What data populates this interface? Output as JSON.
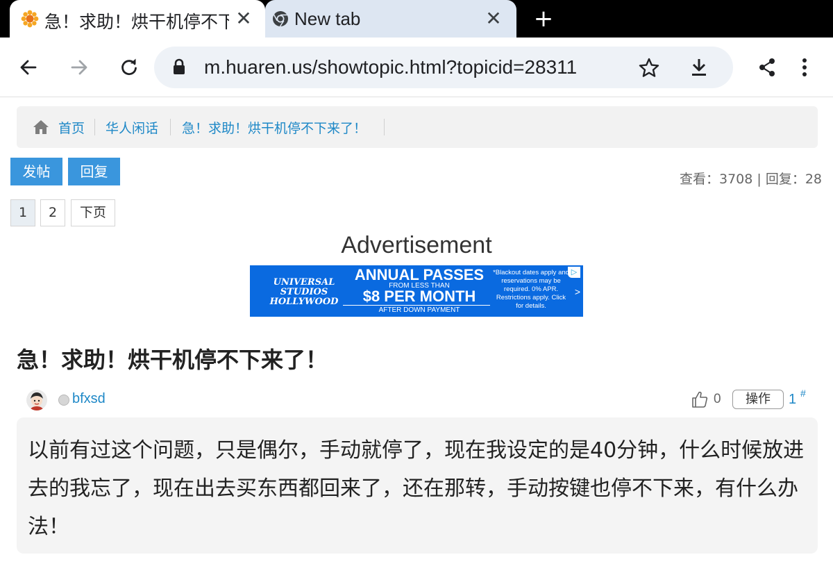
{
  "browser": {
    "tabs": [
      {
        "title": "急！求助！烘干机停不下来了！",
        "active": true,
        "favicon": "sunflower-favicon"
      },
      {
        "title": "New tab",
        "active": false,
        "favicon": "chrome-icon"
      }
    ],
    "new_tab_label": "+",
    "close_label": "✕",
    "url": "m.huaren.us/showtopic.html?topicid=28311",
    "toolbar_icons": [
      "back-arrow-icon",
      "forward-arrow-icon",
      "reload-icon",
      "lock-icon",
      "star-icon",
      "download-icon",
      "share-icon",
      "more-vert-icon"
    ]
  },
  "breadcrumb": {
    "home_icon": "home-icon",
    "items": [
      "首页",
      "华人闲话",
      "急！求助！烘干机停不下来了！"
    ]
  },
  "actions": {
    "post_label": "发帖",
    "reply_label": "回复"
  },
  "stats": {
    "text": "查看：3708 | 回复：28"
  },
  "pager": {
    "pages": [
      "1",
      "2"
    ],
    "next_label": "下页",
    "current": "1"
  },
  "ad": {
    "label": "Advertisement",
    "logo_text": "UNIVERSAL STUDIOS HOLLYWOOD",
    "headline": "ANNUAL PASSES",
    "from_text": "FROM LESS THAN",
    "price": "$8 PER MONTH",
    "after_text": "AFTER DOWN PAYMENT",
    "fine_print": "*Blackout dates apply and reservations may be required. 0% APR. Restrictions apply. Click for details.",
    "arrow": ">",
    "colors": {
      "background": "#0a6ae0"
    }
  },
  "post": {
    "title": "急！求助！烘干机停不下来了！",
    "author": "bfxsd",
    "likes": "0",
    "op_label": "操作",
    "floor": "1",
    "floor_mark": "#",
    "body": "以前有过这个问题，只是偶尔，手动就停了，现在我设定的是40分钟，什么时候放进去的我忘了，现在出去买东西都回来了，还在那转，手动按键也停不下来，有什么办法！"
  },
  "colors": {
    "link": "#1e88c7",
    "button": "#3a96dd",
    "tab_strip": "#000000",
    "inactive_tab": "#dde6f2"
  }
}
